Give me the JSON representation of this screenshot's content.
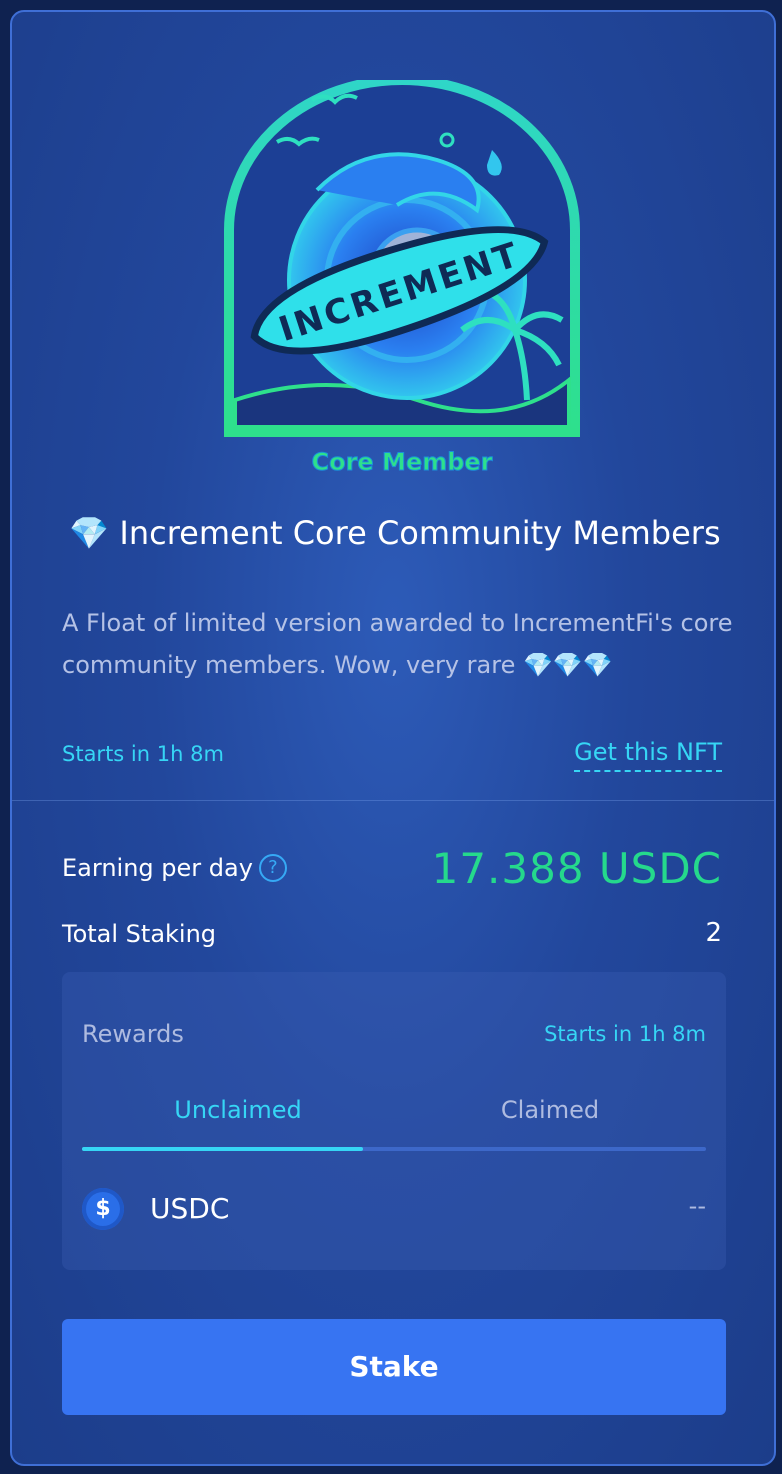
{
  "nft": {
    "art_badge_text": "INCREMENT",
    "art_caption": "Core Member",
    "title_icon": "💎",
    "title": "Increment Core Community Members",
    "description": "A Float of limited version awarded to IncrementFi's core community members. Wow, very rare 💎💎💎",
    "starts_in": "Starts in 1h 8m",
    "get_nft_label": "Get this NFT"
  },
  "stats": {
    "earning_label": "Earning per day",
    "help_icon": "?",
    "earning_value": "17.388 USDC",
    "total_staking_label": "Total Staking",
    "total_staking_value": "2"
  },
  "rewards": {
    "label": "Rewards",
    "starts_in": "Starts in 1h 8m",
    "tabs": [
      {
        "label": "Unclaimed",
        "active": true
      },
      {
        "label": "Claimed",
        "active": false
      }
    ],
    "token": {
      "icon": "$",
      "name": "USDC",
      "amount": "--"
    }
  },
  "actions": {
    "stake_label": "Stake"
  },
  "colors": {
    "accent_cyan": "#36d6f5",
    "earning_green": "#25d98c",
    "button_blue": "#3774f2",
    "card_bg": "#22479c"
  }
}
